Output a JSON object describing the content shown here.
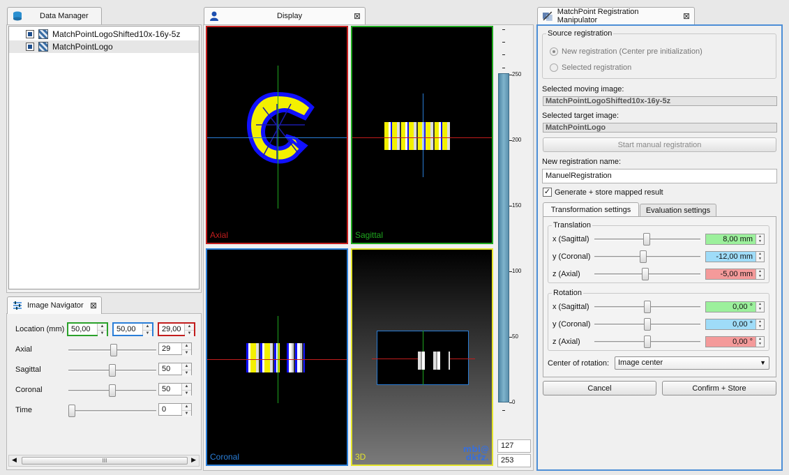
{
  "data_manager": {
    "tab_label": "Data Manager",
    "items": [
      {
        "label": "MatchPointLogoShifted10x-16y-5z",
        "checked": true,
        "selected": false
      },
      {
        "label": "MatchPointLogo",
        "checked": true,
        "selected": true
      }
    ]
  },
  "image_navigator": {
    "tab_label": "Image Navigator",
    "location_label": "Location (mm)",
    "location_values": [
      "50,00",
      "50,00",
      "29,00"
    ],
    "rows": [
      {
        "label": "Axial",
        "value": "29",
        "level": 0.52
      },
      {
        "label": "Sagittal",
        "value": "50",
        "level": 0.5
      },
      {
        "label": "Coronal",
        "value": "50",
        "level": 0.5
      },
      {
        "label": "Time",
        "value": "0",
        "level": 0.0
      }
    ],
    "scroll_grip": "III"
  },
  "display": {
    "tab_label": "Display",
    "views": [
      {
        "label": "Axial",
        "border_color": "#c21d1d",
        "label_color": "#c21d1d"
      },
      {
        "label": "Sagittal",
        "border_color": "#1ea71e",
        "label_color": "#1ea71e"
      },
      {
        "label": "Coronal",
        "border_color": "#2a7ed8",
        "label_color": "#2a7ed8"
      },
      {
        "label": "3D",
        "border_color": "#e4e42a",
        "label_color": "#e4e42a"
      }
    ],
    "scale_ticks": [
      "250",
      "200",
      "150",
      "100",
      "50",
      "0"
    ],
    "level_values": [
      "127",
      "253"
    ],
    "logo_lines": [
      "mbi@",
      "dkfz."
    ]
  },
  "registration": {
    "tab_label": "MatchPoint Registration Manipulator",
    "source_group": "Source registration",
    "radio_new": "New registration (Center pre initialization)",
    "radio_selected": "Selected registration",
    "moving_label": "Selected moving image:",
    "moving_value": "MatchPointLogoShifted10x-16y-5z",
    "target_label": "Selected target image:",
    "target_value": "MatchPointLogo",
    "start_button": "Start manual registration",
    "name_label": "New registration name:",
    "name_value": "ManuelRegistration",
    "generate_label": "Generate + store mapped result",
    "generate_checked": true,
    "tabs": [
      "Transformation settings",
      "Evaluation settings"
    ],
    "translation_group": "Translation",
    "rotation_group": "Rotation",
    "translation_rows": [
      {
        "label": "x (Sagittal)",
        "value": "8,00 mm",
        "color": "#9cf09c",
        "level": 0.49
      },
      {
        "label": "y (Coronal)",
        "value": "-12,00 mm",
        "color": "#9fdcf8",
        "level": 0.46
      },
      {
        "label": "z (Axial)",
        "value": "-5,00 mm",
        "color": "#f49a9a",
        "level": 0.48
      }
    ],
    "rotation_rows": [
      {
        "label": "x (Sagittal)",
        "value": "0,00 °",
        "color": "#9cf09c",
        "level": 0.5
      },
      {
        "label": "y (Coronal)",
        "value": "0,00 °",
        "color": "#9fdcf8",
        "level": 0.5
      },
      {
        "label": "z (Axial)",
        "value": "0,00 °",
        "color": "#f49a9a",
        "level": 0.5
      }
    ],
    "center_label": "Center of rotation:",
    "center_value": "Image center",
    "cancel_button": "Cancel",
    "confirm_button": "Confirm + Store"
  }
}
